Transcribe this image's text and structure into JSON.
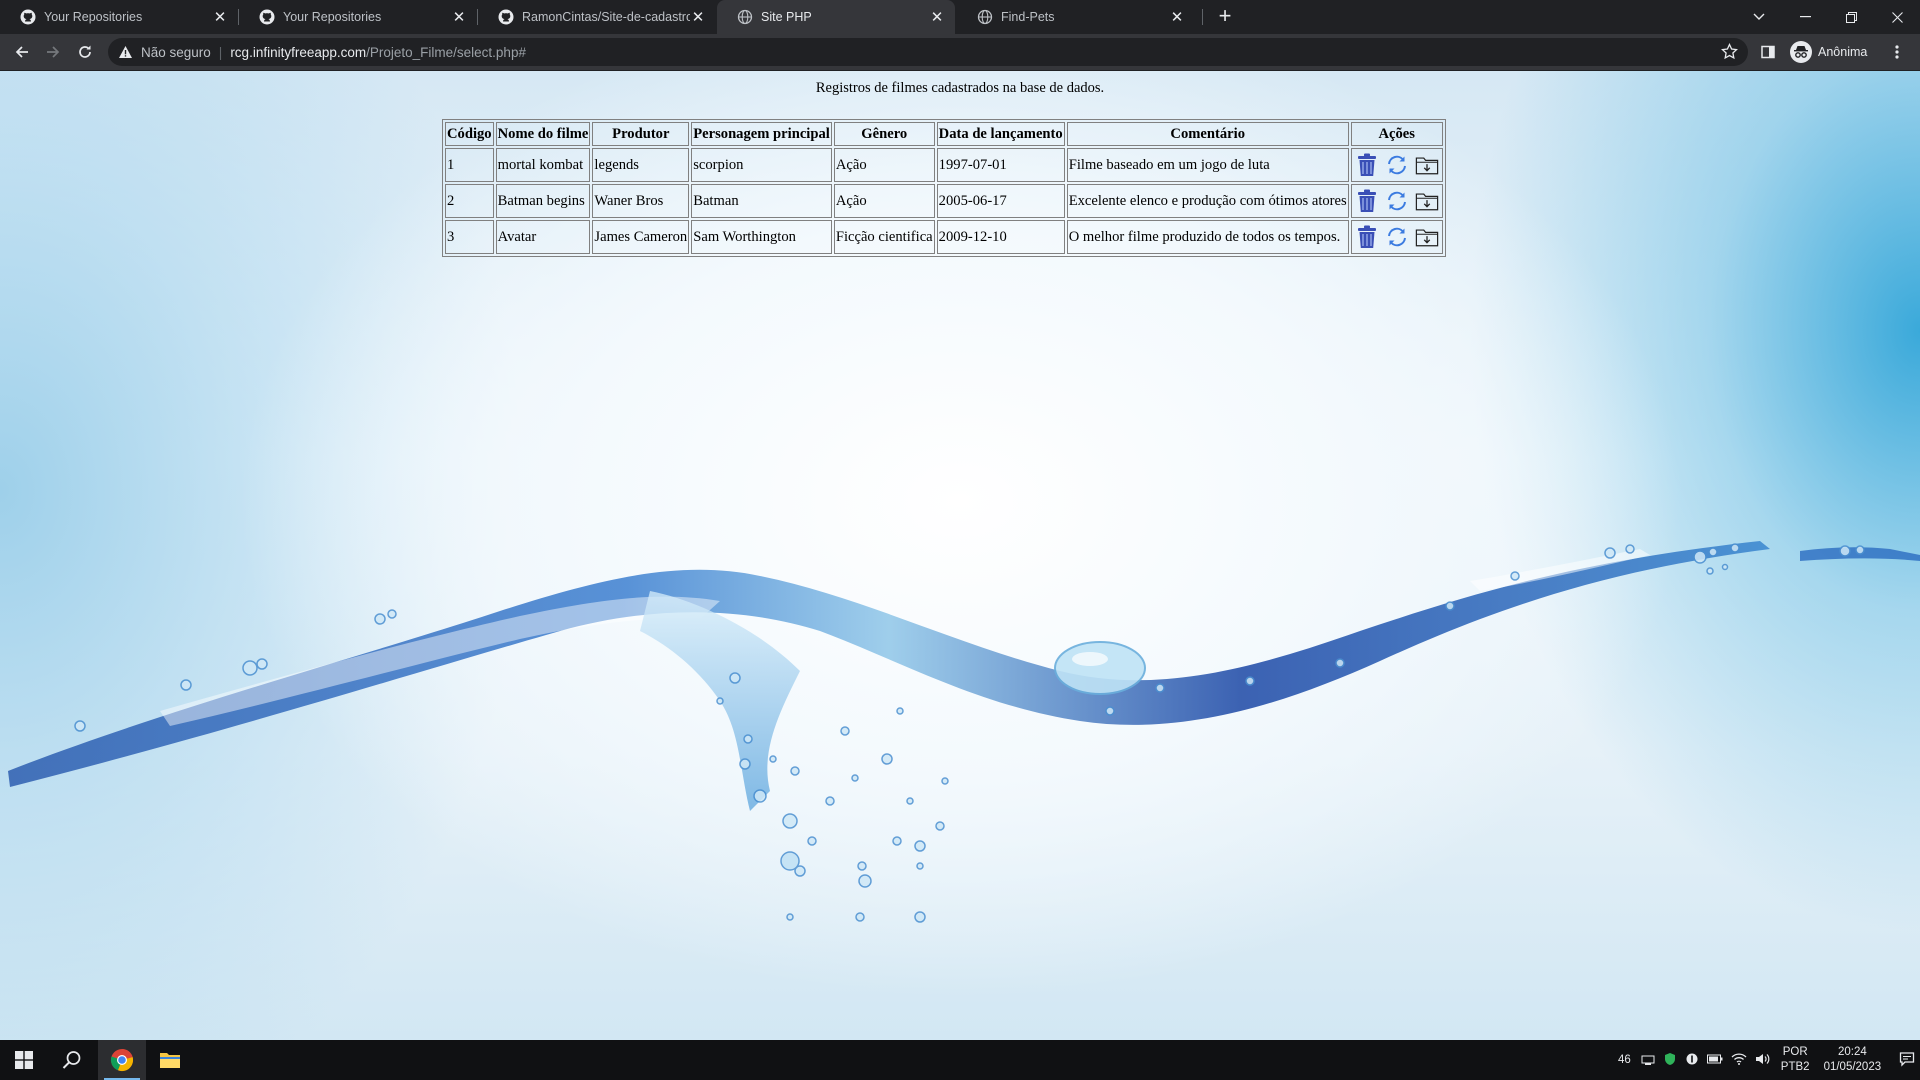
{
  "tabs": [
    {
      "title": "Your Repositories",
      "favicon": "github-icon"
    },
    {
      "title": "Your Repositories",
      "favicon": "github-icon"
    },
    {
      "title": "RamonCintas/Site-de-cadastro-d",
      "favicon": "github-icon"
    },
    {
      "title": "Site PHP",
      "favicon": "globe-icon",
      "active": true
    },
    {
      "title": "Find-Pets",
      "favicon": "globe-icon"
    }
  ],
  "omnibox": {
    "security_label": "Não seguro",
    "host": "rcg.infinityfreeapp.com",
    "path": "/Projeto_Filme/select.php#"
  },
  "profile": {
    "label": "Anônima"
  },
  "page": {
    "caption": "Registros de filmes cadastrados na base de dados.",
    "table": {
      "headers": [
        "Código",
        "Nome do filme",
        "Produtor",
        "Personagem principal",
        "Gênero",
        "Data de lançamento",
        "Comentário",
        "Ações"
      ],
      "rows": [
        [
          "1",
          "mortal kombat",
          "legends",
          "scorpion",
          "Ação",
          "1997-07-01",
          "Filme baseado em um jogo de luta"
        ],
        [
          "2",
          "Batman begins",
          "Waner Bros",
          "Batman",
          "Ação",
          "2005-06-17",
          "Excelente elenco e produção com ótimos atores"
        ],
        [
          "3",
          "Avatar",
          "James Cameron",
          "Sam Worthington",
          "Ficção cientifica",
          "2009-12-10",
          "O melhor filme produzido de todos os tempos."
        ]
      ],
      "actions": [
        "trash-icon",
        "refresh-icon",
        "folder-download-icon"
      ]
    }
  },
  "taskbar": {
    "tray_number": "46",
    "lang_1": "POR",
    "lang_2": "PTB2",
    "time": "20:24",
    "date": "01/05/2023"
  },
  "colors": {
    "chrome_dark": "#202124",
    "chrome_tab_active": "#35363a",
    "trash_blue": "#3a4fb6",
    "refresh_blue": "#3b7be0",
    "taskbar": "#101113"
  }
}
